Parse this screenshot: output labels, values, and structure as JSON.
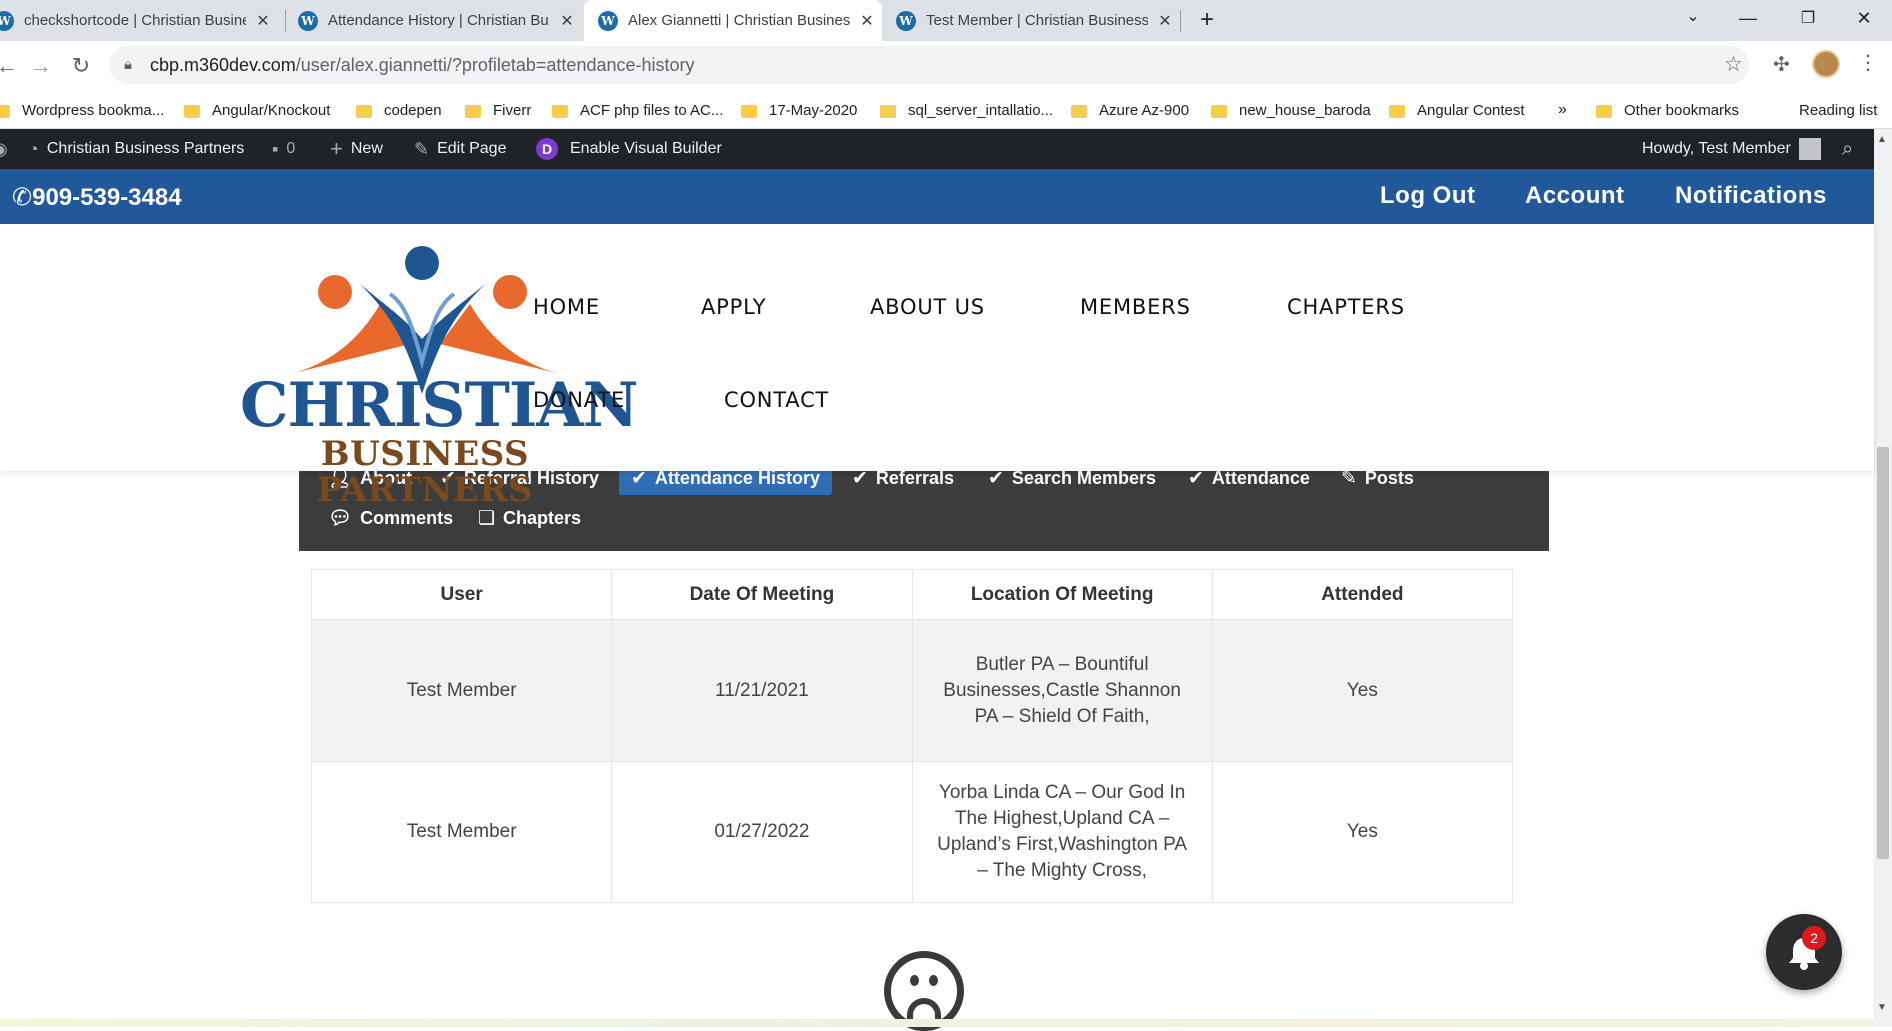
{
  "browser": {
    "tabs": [
      {
        "title": "checkshortcode | Christian Busine"
      },
      {
        "title": "Attendance History | Christian Bu"
      },
      {
        "title": "Alex Giannetti | Christian Busines"
      },
      {
        "title": "Test Member | Christian Business"
      }
    ],
    "active_tab_index": 2,
    "url_host": "cbp.m360dev.com",
    "url_path": "/user/alex.giannetti/?profiletab=attendance-history",
    "bookmarks": [
      "Wordpress bookma...",
      "Angular/Knockout",
      "codepen",
      "Fiverr",
      "ACF php files to AC...",
      "17-May-2020",
      "sql_server_intallatio...",
      "Azure Az-900",
      "new_house_baroda",
      "Angular Contest"
    ],
    "overflow_label": "»",
    "other_bookmarks": "Other bookmarks",
    "reading_list": "Reading list"
  },
  "adminbar": {
    "site_name": "Christian Business Partners",
    "comments_count": "0",
    "new_label": "New",
    "edit_label": "Edit Page",
    "builder_label": "Enable Visual Builder",
    "howdy": "Howdy, Test Member"
  },
  "topbar": {
    "phone": "909-539-3484",
    "logout": "Log Out",
    "account": "Account",
    "notifications": "Notifications"
  },
  "logo": {
    "line1": "CHRISTIAN",
    "line2": "BUSINESS PARTNERS"
  },
  "nav": {
    "home": "HOME",
    "apply": "APPLY",
    "about": "ABOUT US",
    "members": "MEMBERS",
    "chapters": "CHAPTERS",
    "donate": "DONATE",
    "contact": "CONTACT"
  },
  "profile_tabs": {
    "about": "About",
    "referral_history": "Referral History",
    "attendance_history": "Attendance History",
    "referrals": "Referrals",
    "search_members": "Search Members",
    "attendance": "Attendance",
    "posts": "Posts",
    "comments": "Comments",
    "chapters": "Chapters"
  },
  "table": {
    "headers": [
      "User",
      "Date Of Meeting",
      "Location Of Meeting",
      "Attended"
    ],
    "rows": [
      {
        "user": "Test Member",
        "date": "11/21/2021",
        "location": "Butler PA – Bountiful Businesses,Castle Shannon PA – Shield Of Faith,",
        "attended": "Yes"
      },
      {
        "user": "Test Member",
        "date": "01/27/2022",
        "location": "Yorba Linda CA – Our God In The Highest,Upland CA – Upland’s First,Washington PA – The Mighty Cross,",
        "attended": "Yes"
      }
    ]
  },
  "notification_badge": "2",
  "colors": {
    "brand_blue": "#21589a",
    "admin_bar": "#1d2327",
    "panel_dark": "#3c3c3c",
    "active_tab": "#2f6eb5",
    "logo_orange": "#e8692b",
    "logo_blue": "#1f5590",
    "logo_brown": "#7a4a1e"
  }
}
